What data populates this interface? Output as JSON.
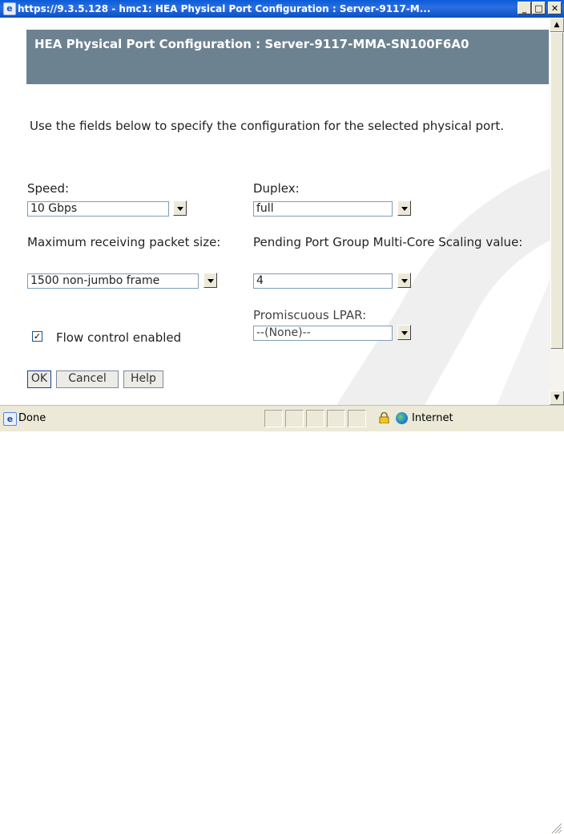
{
  "window": {
    "title": "https://9.3.5.128 - hmc1: HEA Physical Port Configuration : Server-9117-M...",
    "minimize_label": "_",
    "maximize_label": "□",
    "close_label": "✕"
  },
  "dialog": {
    "heading": "HEA Physical Port Configuration : Server-9117-MMA-SN100F6A0",
    "intro": "Use the fields below to specify the configuration for the selected physical port.",
    "fields": {
      "speed": {
        "label": "Speed:",
        "value": "10 Gbps"
      },
      "duplex": {
        "label": "Duplex:",
        "value": "full"
      },
      "max_packet": {
        "label": "Maximum receiving packet size:",
        "value": "1500 non-jumbo frame"
      },
      "pending_scaling": {
        "label": "Pending Port Group Multi-Core Scaling value:",
        "value": "4"
      },
      "promiscuous": {
        "label": "Promiscuous LPAR:",
        "value": "--(None)--"
      },
      "flow_control": {
        "label": "Flow control enabled",
        "checked": true,
        "check_mark": "✓"
      }
    },
    "buttons": {
      "ok": "OK",
      "cancel": "Cancel",
      "help": "Help"
    }
  },
  "statusbar": {
    "status": "Done",
    "zone": "Internet"
  },
  "icons": {
    "title_icon": "ie-page-icon",
    "status_icon": "ie-page-icon",
    "lock": "lock-icon",
    "globe": "globe-icon"
  },
  "colors": {
    "titlebar": "#0a5bd8",
    "header_band": "#6d8291",
    "field_border": "#7f9db9"
  }
}
